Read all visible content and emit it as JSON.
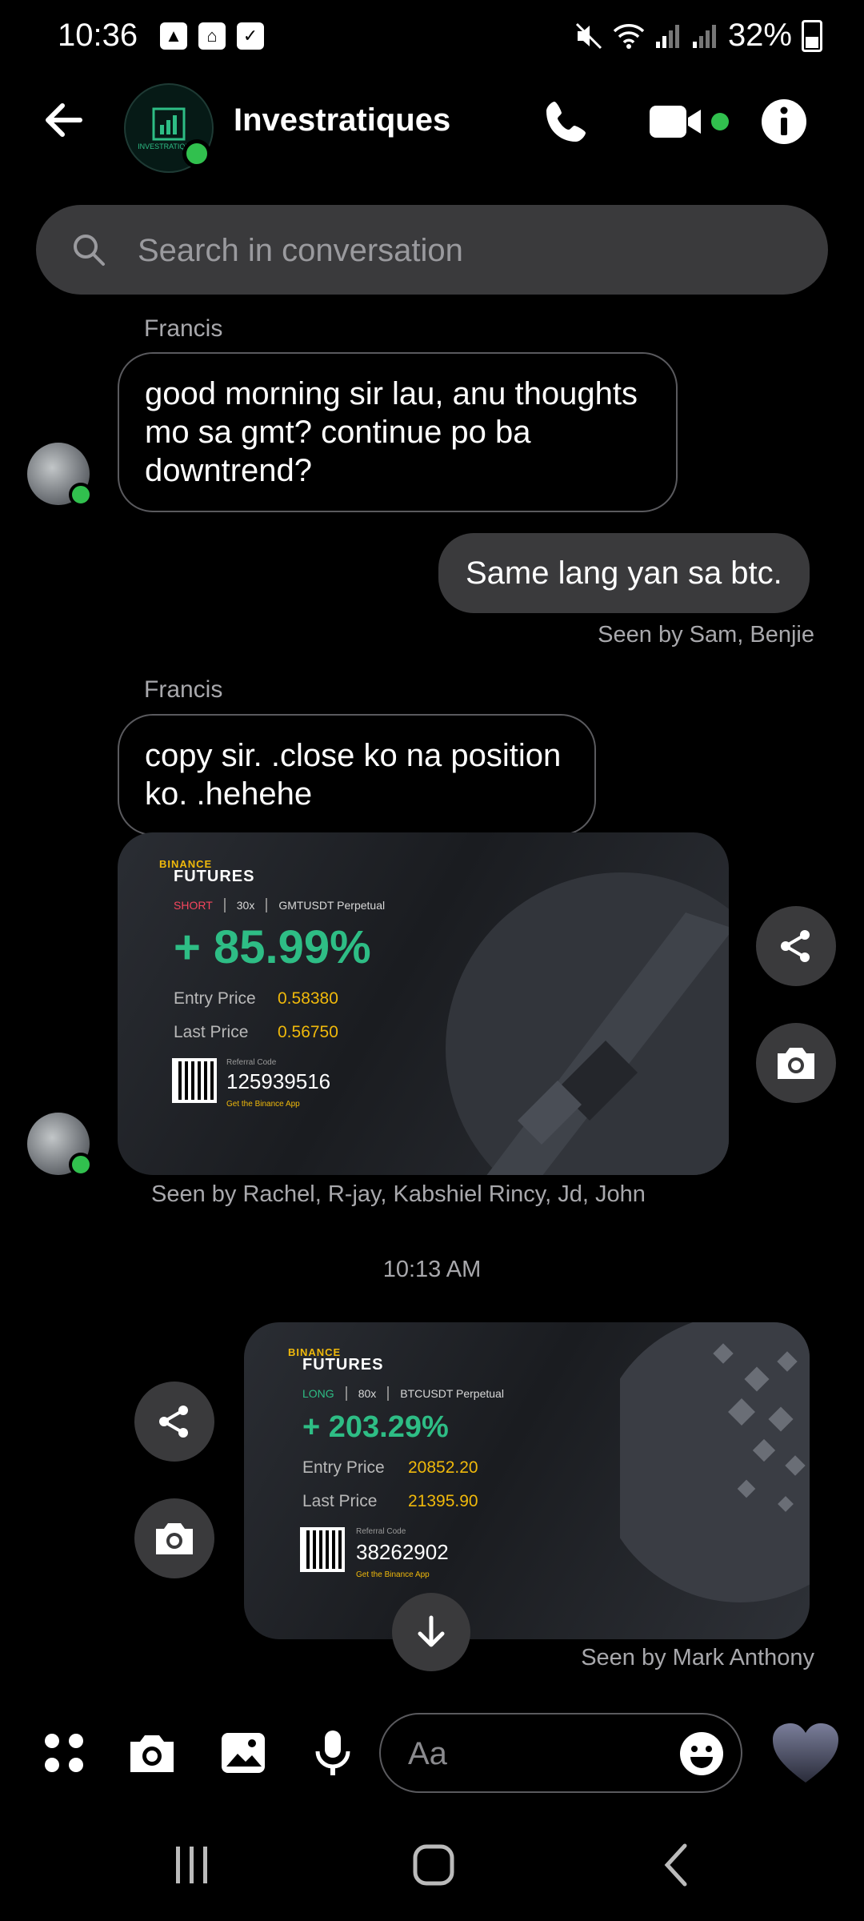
{
  "status_bar": {
    "time": "10:36",
    "battery": "32%"
  },
  "header": {
    "title": "Investratiques",
    "avatar_text": "INVESTRATIQUES"
  },
  "search": {
    "placeholder": "Search in conversation"
  },
  "messages": {
    "m1": {
      "sender": "Francis",
      "text": "good morning sir lau, anu thoughts mo sa gmt? continue po ba downtrend?"
    },
    "m2": {
      "text": "Same lang yan sa btc.",
      "seen": "Seen by Sam, Benjie"
    },
    "m3": {
      "sender": "Francis",
      "text": "copy sir. .close ko na position ko. .hehehe"
    },
    "m4": {
      "seen": "Seen by Rachel, R-jay, Kabshiel Rincy, Jd, John"
    },
    "timestamp": "10:13 AM",
    "m5": {
      "seen": "Seen by Mark Anthony"
    }
  },
  "card1": {
    "brand_small": "BINANCE",
    "brand_big": "FUTURES",
    "side": "SHORT",
    "leverage": "30x",
    "pair": "GMTUSDT Perpetual",
    "pnl": "+ 85.99%",
    "entry_label": "Entry Price",
    "entry": "0.58380",
    "last_label": "Last Price",
    "last": "0.56750",
    "ref_label": "Referral Code",
    "ref_code": "125939516",
    "app_label": "Get the Binance App",
    "side_color": "#f6465d"
  },
  "card2": {
    "brand_small": "BINANCE",
    "brand_big": "FUTURES",
    "side": "LONG",
    "leverage": "80x",
    "pair": "BTCUSDT Perpetual",
    "pnl": "+ 203.29%",
    "entry_label": "Entry Price",
    "entry": "20852.20",
    "last_label": "Last Price",
    "last": "21395.90",
    "ref_label": "Referral Code",
    "ref_code": "38262902",
    "app_label": "Get the Binance App",
    "side_color": "#2ebd85"
  },
  "composer": {
    "placeholder": "Aa"
  },
  "colors": {
    "online": "#31c04e",
    "binance_yellow": "#f0b90b",
    "profit_green": "#2ebd85",
    "bubble_out": "#3a3a3c"
  },
  "icons": [
    "back-arrow-icon",
    "phone-icon",
    "video-icon",
    "info-icon",
    "search-icon",
    "share-icon",
    "camera-icon",
    "apps-icon",
    "image-icon",
    "mic-icon",
    "emoji-icon",
    "heart-icon",
    "scroll-down-icon",
    "recents-icon",
    "home-icon",
    "nav-back-icon"
  ]
}
